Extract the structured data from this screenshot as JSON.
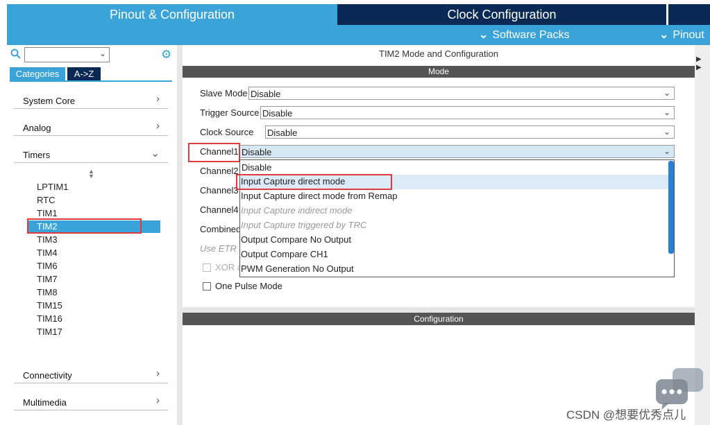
{
  "tabs": {
    "pinout": "Pinout & Configuration",
    "clock": "Clock Configuration"
  },
  "subbar": {
    "software_packs": "Software Packs",
    "pinout": "Pinout"
  },
  "sidebar": {
    "search_value": "",
    "categories_label": "Categories",
    "az_label": "A->Z",
    "cats": {
      "system_core": "System Core",
      "analog": "Analog",
      "timers": "Timers",
      "connectivity": "Connectivity",
      "multimedia": "Multimedia"
    },
    "timers": [
      "LPTIM1",
      "RTC",
      "TIM1",
      "TIM2",
      "TIM3",
      "TIM4",
      "TIM6",
      "TIM7",
      "TIM8",
      "TIM15",
      "TIM16",
      "TIM17"
    ],
    "selected": "TIM2"
  },
  "main": {
    "title": "TIM2 Mode and Configuration",
    "mode_header": "Mode",
    "config_header": "Configuration",
    "fields": {
      "slave_mode": {
        "label": "Slave Mode",
        "value": "Disable"
      },
      "trigger_source": {
        "label": "Trigger Source",
        "value": "Disable"
      },
      "clock_source": {
        "label": "Clock Source",
        "value": "Disable"
      },
      "channel1": {
        "label": "Channel1",
        "value": "Disable"
      },
      "channel2": {
        "label": "Channel2"
      },
      "channel3": {
        "label": "Channel3"
      },
      "channel4": {
        "label": "Channel4"
      },
      "combined": {
        "label": "Combined"
      },
      "use_etr": {
        "label": "Use ETR"
      },
      "xor": {
        "label": "XOR a"
      },
      "one_pulse": {
        "label": "One Pulse Mode"
      }
    },
    "dropdown_options": [
      {
        "label": "Disable",
        "enabled": true
      },
      {
        "label": "Input Capture direct mode",
        "enabled": true
      },
      {
        "label": "Input Capture direct mode from Remap",
        "enabled": true
      },
      {
        "label": "Input Capture indirect mode",
        "enabled": false
      },
      {
        "label": "Input Capture triggered by TRC",
        "enabled": false
      },
      {
        "label": "Output Compare No Output",
        "enabled": true
      },
      {
        "label": "Output Compare CH1",
        "enabled": true
      },
      {
        "label": "PWM Generation No Output",
        "enabled": true
      }
    ],
    "highlighted_option": "Input Capture direct mode"
  },
  "watermark": "CSDN @想要优秀点儿",
  "colors": {
    "accent": "#3aa3d8",
    "dark": "#0a2a55",
    "highlight_red": "#e03a3a"
  }
}
